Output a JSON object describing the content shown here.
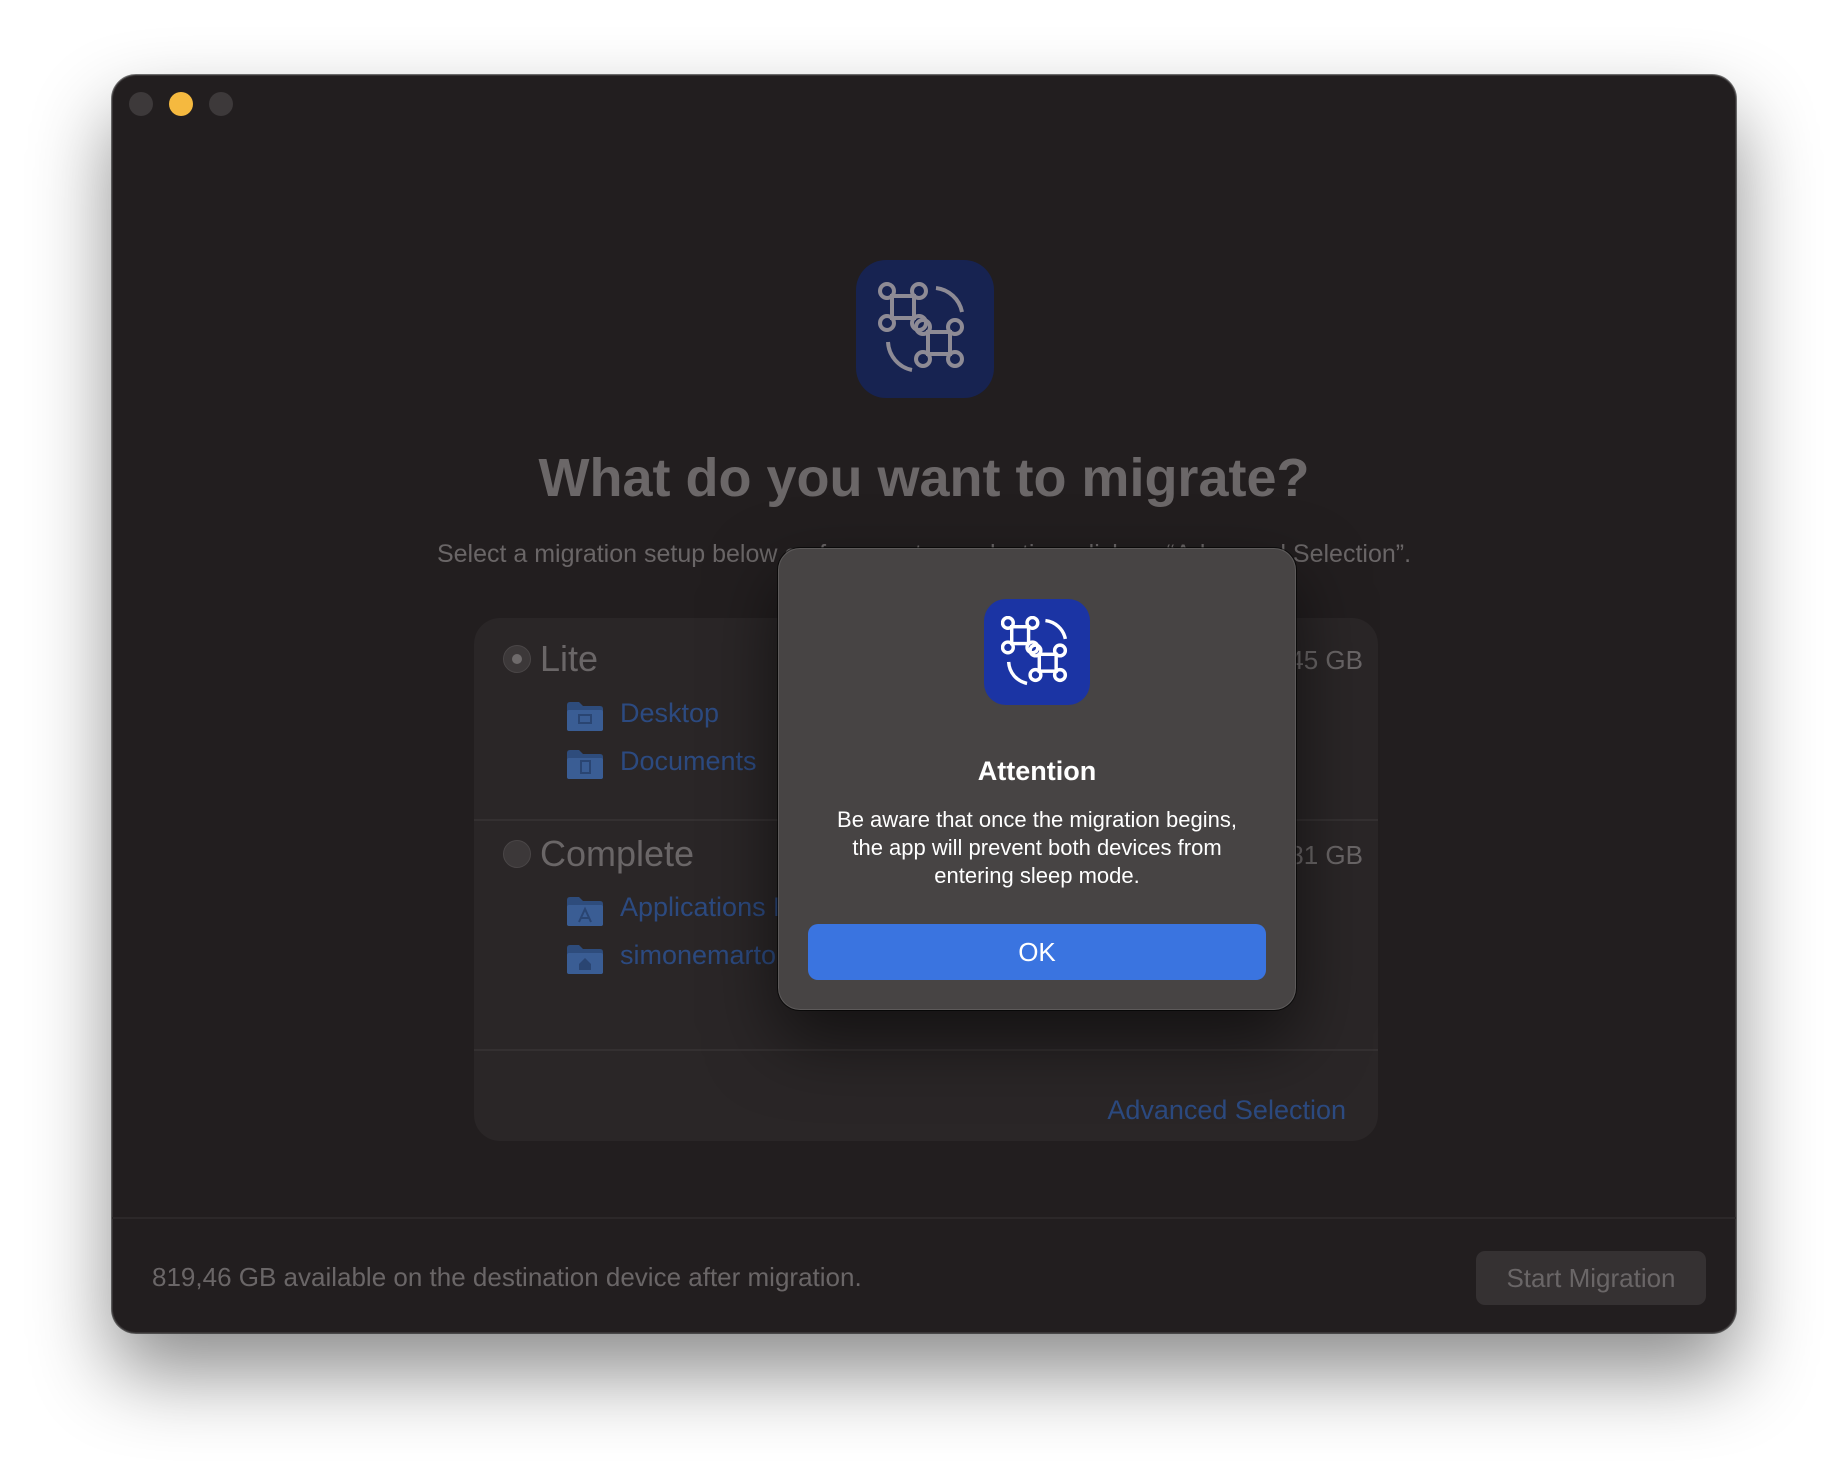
{
  "window": {
    "headline": "What do you want to migrate?",
    "subtitle": "Select a migration setup below or, for a custom selection, click on “Advanced Selection”."
  },
  "options": [
    {
      "title": "Lite",
      "size": "1,45 GB",
      "selected": true,
      "folders": [
        {
          "label": "Desktop",
          "icon": "desktop-folder-icon"
        },
        {
          "label": "Documents",
          "icon": "documents-folder-icon"
        }
      ]
    },
    {
      "title": "Complete",
      "size": "31,81 GB",
      "selected": false,
      "folders": [
        {
          "label": "Applications Folder",
          "icon": "applications-folder-icon"
        },
        {
          "label": "simonemartorelli.max.m3 Folder",
          "icon": "home-folder-icon"
        }
      ]
    }
  ],
  "advanced_selection": "Advanced Selection",
  "footer": {
    "available_text": "819,46 GB available on the destination device after migration.",
    "start_button": "Start Migration"
  },
  "dialog": {
    "title": "Attention",
    "message": "Be aware that once the migration begins,\nthe app will prevent both devices from\nentering sleep mode.",
    "ok_button": "OK"
  },
  "colors": {
    "window_bg": "#221e1f",
    "accent": "#3a74e0",
    "minimize_button": "#f5b93f"
  }
}
